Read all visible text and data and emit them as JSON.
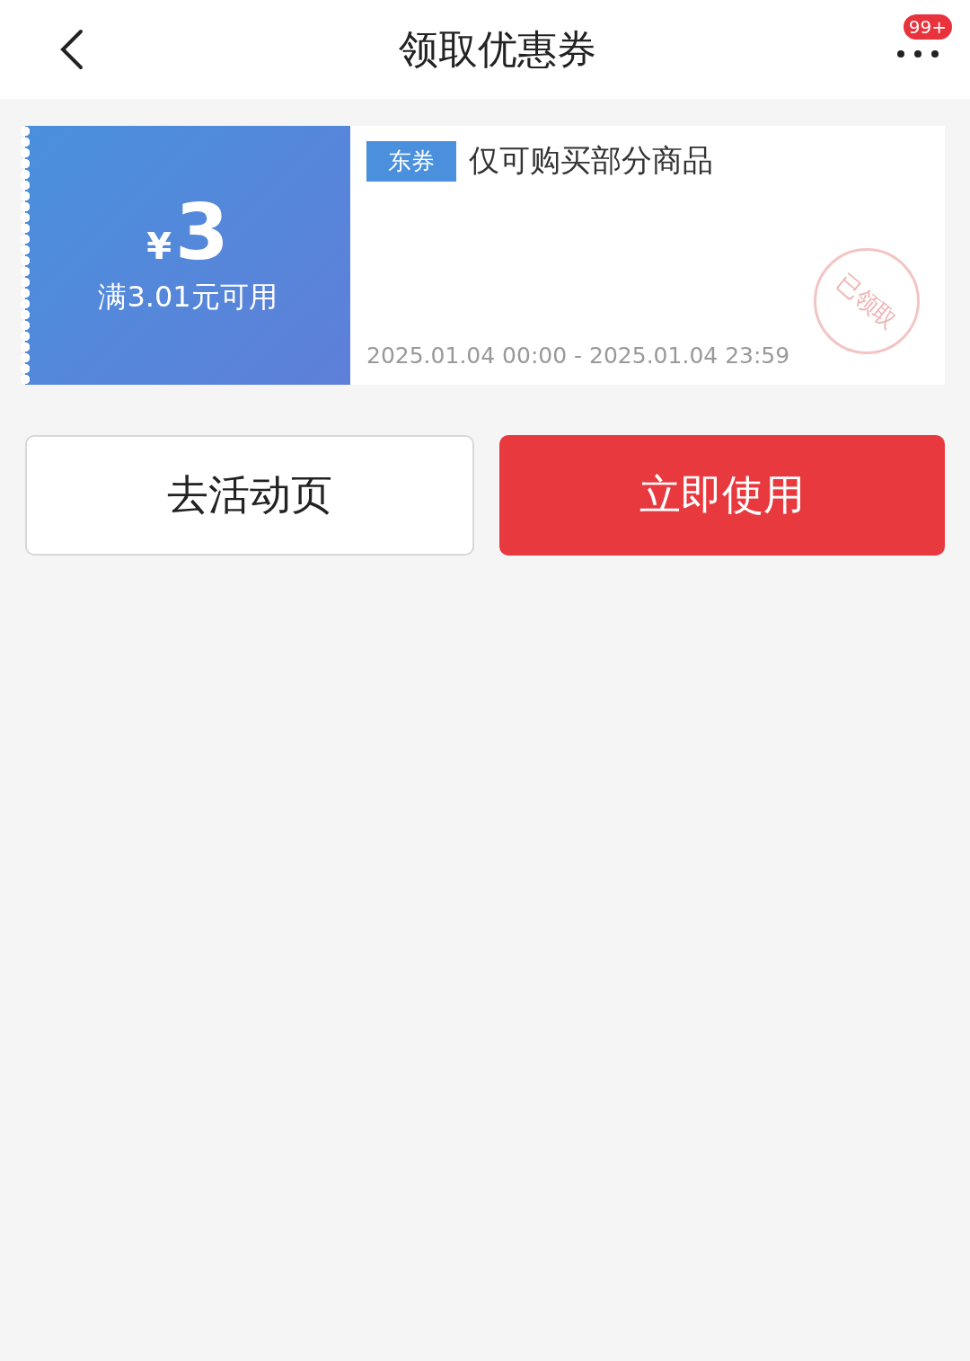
{
  "header": {
    "title": "领取优惠券",
    "badge": "99+"
  },
  "coupon": {
    "currency": "¥",
    "amount": "3",
    "condition": "满3.01元可用",
    "tag": "东券",
    "scope": "仅可购买部分商品",
    "validity": "2025.01.04 00:00 - 2025.01.04 23:59",
    "stamp": "已领取"
  },
  "buttons": [
    {
      "label": "去活动页",
      "kind": "secondary"
    },
    {
      "label": "立即使用",
      "kind": "primary"
    }
  ]
}
